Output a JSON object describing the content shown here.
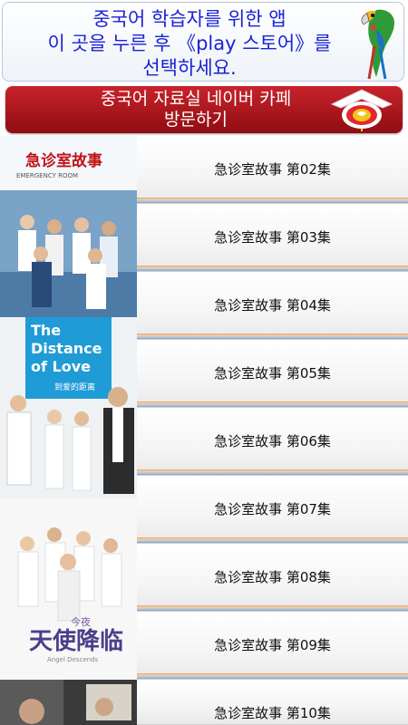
{
  "header_banner": {
    "lines": [
      "중국어 학습자를 위한 앱",
      "이 곳을 누른 후 《play 스토어》를",
      "선택하세요."
    ],
    "accent_color": "#1a22d6",
    "icon": "parrot-icon"
  },
  "cafe_banner": {
    "lines": [
      "중국어 자료실 네이버 카페",
      "방문하기"
    ],
    "icon": "lantern-icon",
    "bg_color": "#b81d24"
  },
  "posters": [
    {
      "icon": "emergency-room-poster",
      "title": "急诊室故事",
      "subtitle": "EMERGENCY ROOM"
    },
    {
      "icon": "distance-of-love-poster",
      "title": "The Distance of Love",
      "subtitle": "到爱的距离"
    },
    {
      "icon": "angel-descends-poster",
      "title": "天使降临",
      "subtitle": "今夜"
    },
    {
      "icon": "drama-poster-partial"
    }
  ],
  "episodes": [
    {
      "label": "急诊室故事 第02集"
    },
    {
      "label": "急诊室故事 第03集"
    },
    {
      "label": "急诊室故事 第04集"
    },
    {
      "label": "急诊室故事 第05集"
    },
    {
      "label": "急诊室故事 第06集"
    },
    {
      "label": "急诊室故事 第07集"
    },
    {
      "label": "急诊室故事 第08集"
    },
    {
      "label": "急诊室故事 第09集"
    },
    {
      "label": "急诊室故事 第10集"
    }
  ]
}
